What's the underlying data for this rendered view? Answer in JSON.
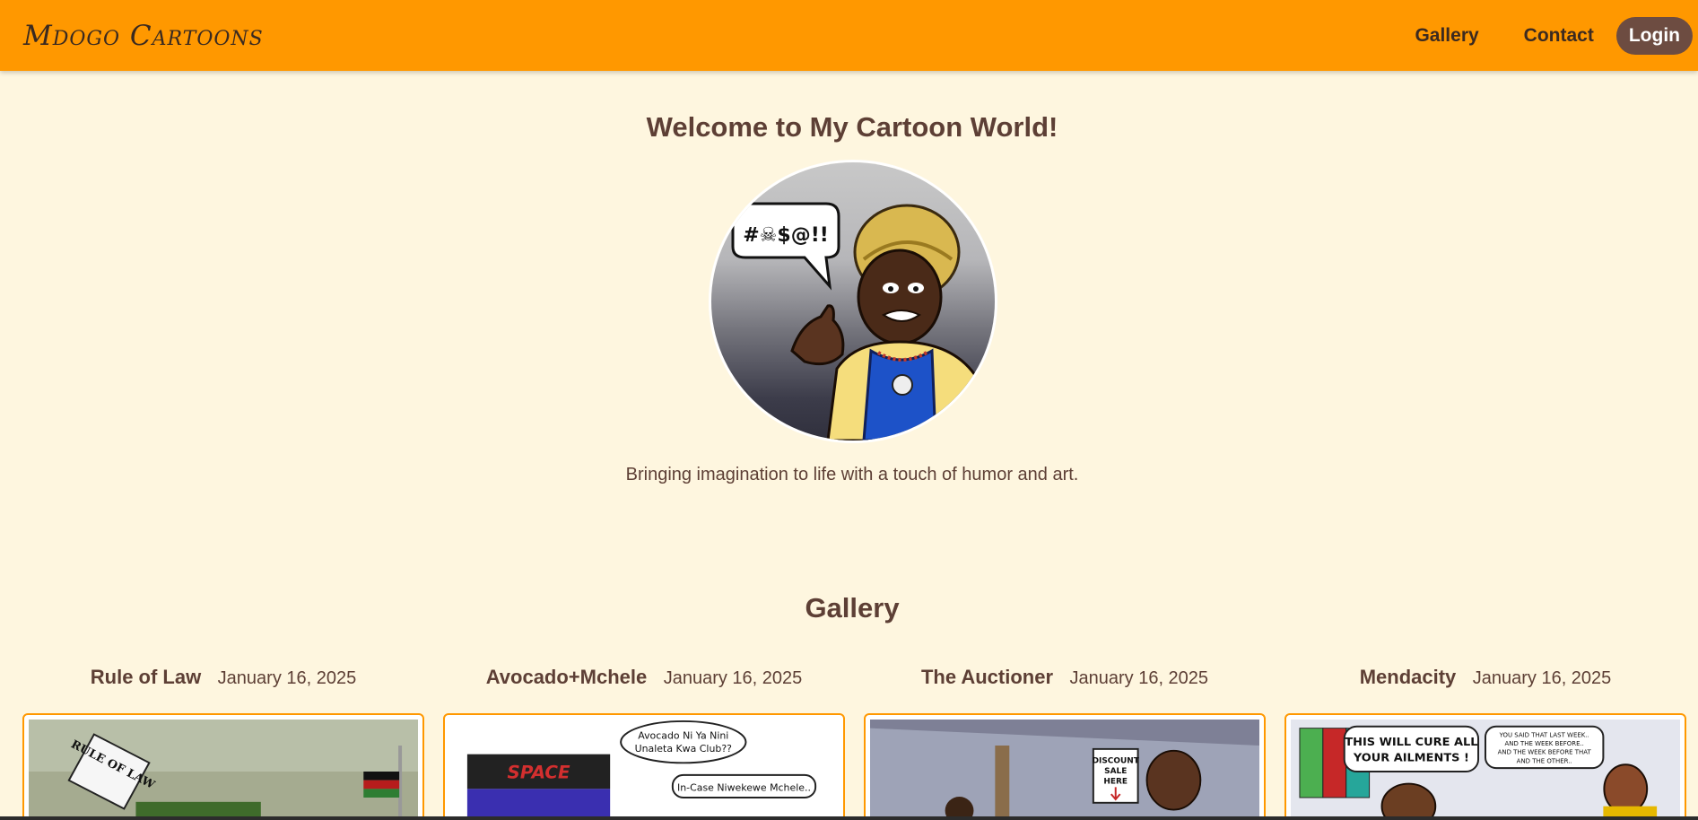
{
  "nav": {
    "brand": "Mdogo Cartoons",
    "links": [
      "Gallery",
      "Contact"
    ],
    "login": "Login"
  },
  "hero": {
    "title": "Welcome to My Cartoon World!",
    "bubble_text": "#☠$@!!",
    "subtitle": "Bringing imagination to life with a touch of humor and art."
  },
  "gallery": {
    "title": "Gallery",
    "items": [
      {
        "title": "Rule of Law",
        "date": "January 16, 2025",
        "image_text": "RULE OF LAW"
      },
      {
        "title": "Avocado+Mchele",
        "date": "January 16, 2025",
        "image_text": "SPACE",
        "bubble1_line1": "Avocado Ni Ya Nini",
        "bubble1_line2": "Unaleta Kwa Club??",
        "bubble2": "In-Case Niwekewe Mchele.."
      },
      {
        "title": "The Auctioner",
        "date": "January 16, 2025",
        "sign_line1": "DISCOUNT",
        "sign_line2": "SALE",
        "sign_line3": "HERE"
      },
      {
        "title": "Mendacity",
        "date": "January 16, 2025",
        "bubble1_line1": "THIS WILL CURE ALL",
        "bubble1_line2": "YOUR AILMENTS !",
        "bubble2_line1": "YOU SAID THAT LAST WEEK..",
        "bubble2_line2": "AND THE WEEK BEFORE..",
        "bubble2_line3": "AND THE WEEK BEFORE THAT",
        "bubble2_line4": "AND THE OTHER.."
      }
    ]
  },
  "colors": {
    "navbar": "#ff9800",
    "background": "#fef6df",
    "text": "#5d3f35",
    "login_button": "#6d4c41",
    "card_border": "#ff9800"
  }
}
